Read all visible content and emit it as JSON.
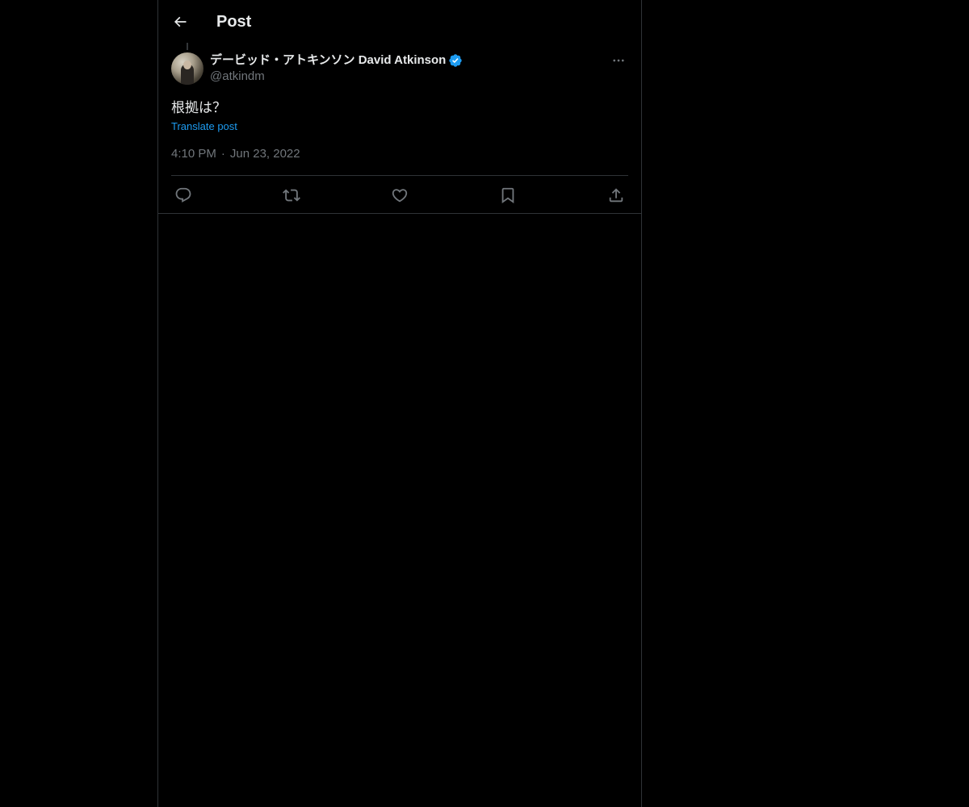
{
  "header": {
    "title": "Post",
    "back_icon": "arrow-left-icon"
  },
  "post": {
    "author": {
      "display_name": "デービッド・アトキンソン David Atkinson",
      "handle": "@atkindm",
      "verified": true,
      "verified_color": "#1d9bf0"
    },
    "text": "根拠は？",
    "translate_label": "Translate post",
    "time": "4:10 PM",
    "separator": "·",
    "date": "Jun 23, 2022",
    "actions": [
      {
        "name": "reply",
        "icon": "reply-icon"
      },
      {
        "name": "repost",
        "icon": "repost-icon"
      },
      {
        "name": "like",
        "icon": "heart-icon"
      },
      {
        "name": "bookmark",
        "icon": "bookmark-icon"
      },
      {
        "name": "share",
        "icon": "share-icon"
      }
    ]
  },
  "colors": {
    "background": "#000000",
    "text_primary": "#e7e9ea",
    "text_secondary": "#71767b",
    "accent": "#1d9bf0",
    "border": "#2f3336"
  }
}
